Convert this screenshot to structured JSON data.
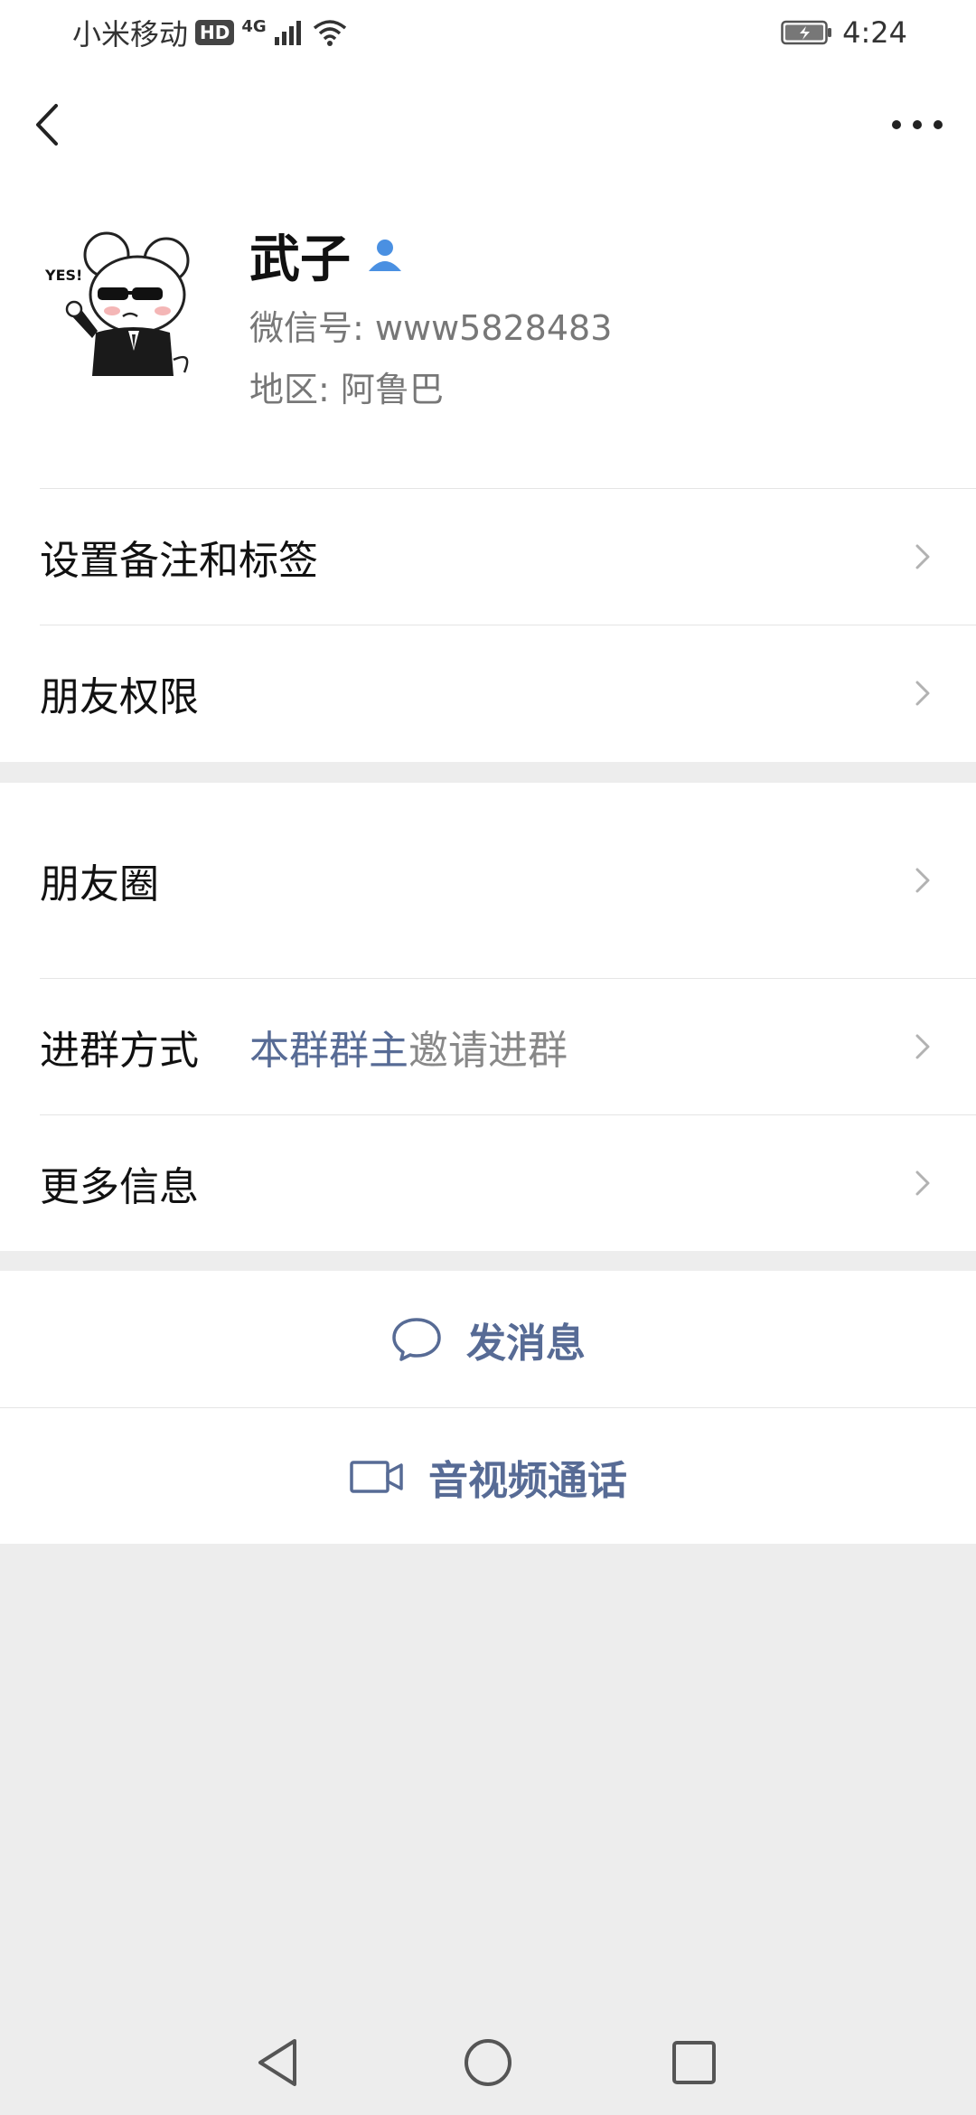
{
  "status_bar": {
    "carrier": "小米移动",
    "hd": "HD",
    "network": "4G",
    "time": "4:24"
  },
  "profile": {
    "name": "武子",
    "wechat_id_label": "微信号:",
    "wechat_id": "www5828483",
    "region_label": "地区:",
    "region": "阿鲁巴",
    "avatar_text": "YES!"
  },
  "rows_group1": [
    {
      "label": "设置备注和标签"
    },
    {
      "label": "朋友权限"
    }
  ],
  "rows_group2": {
    "moments": "朋友圈",
    "join_method_label": "进群方式",
    "join_method_highlight": "本群群主",
    "join_method_rest": "邀请进群",
    "more_info": "更多信息"
  },
  "actions": {
    "send_message": "发消息",
    "av_call": "音视频通话"
  },
  "colors": {
    "link": "#576b95",
    "background": "#ededed"
  }
}
